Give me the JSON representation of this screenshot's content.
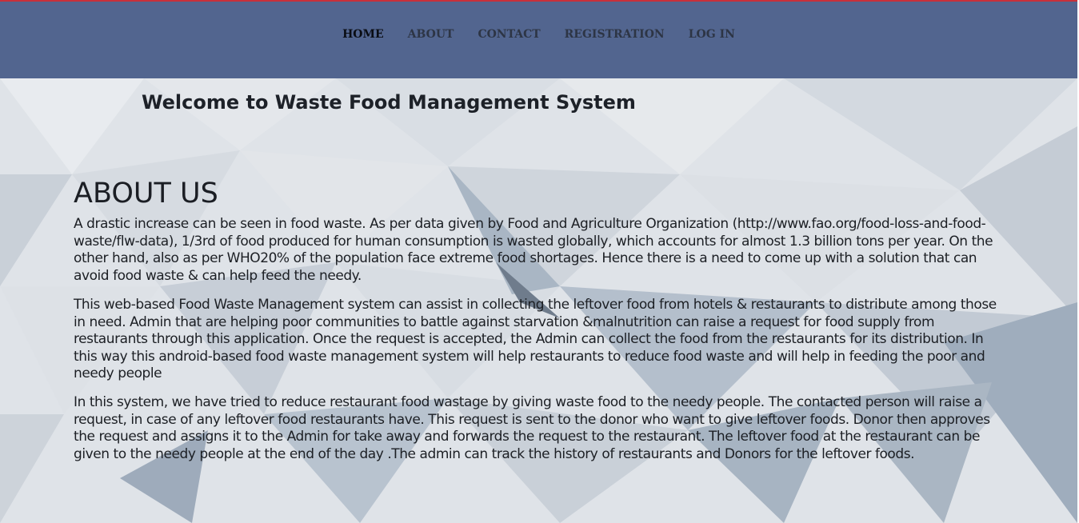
{
  "nav": {
    "items": [
      {
        "label": "HOME",
        "active": true
      },
      {
        "label": "ABOUT",
        "active": false
      },
      {
        "label": "CONTACT",
        "active": false
      },
      {
        "label": "REGISTRATION",
        "active": false
      },
      {
        "label": "LOG IN",
        "active": false
      }
    ]
  },
  "colors": {
    "navbar": "#52658f",
    "top_accent": "#c8303a",
    "text": "#1c1f24"
  },
  "main": {
    "welcome": "Welcome to Waste Food Management System",
    "about_title": "ABOUT US",
    "paragraphs": [
      "A drastic increase can be seen in food waste. As per data given by Food and Agriculture Organization (http://www.fao.org/food-loss-and-food-waste/flw-data), 1/3rd of food produced for human consumption is wasted globally, which accounts for almost 1.3 billion tons per year. On the other hand, also as per WHO20% of the population face extreme food shortages. Hence there is a need to come up with a solution that can avoid food waste & can help feed the needy.",
      "This web-based Food Waste Management system can assist in collecting the leftover food from hotels & restaurants to distribute among those in need. Admin that are helping poor communities to battle against starvation &malnutrition can raise a request for food supply from restaurants through this application. Once the request is accepted, the Admin can collect the food from the restaurants for its distribution. In this way this android-based food waste management system will help restaurants to reduce food waste and will help in feeding the poor and needy people",
      "In this system, we have tried to reduce restaurant food wastage by giving waste food to the needy people. The contacted person will raise a request, in case of any leftover food restaurants have. This request is sent to the donor who want to give leftover foods. Donor then approves the request and assigns it to the Admin for take away and forwards the request to the restaurant. The leftover food at the restaurant can be given to the needy people at the end of the day .The admin can track the history of restaurants and Donors for the leftover foods."
    ]
  }
}
